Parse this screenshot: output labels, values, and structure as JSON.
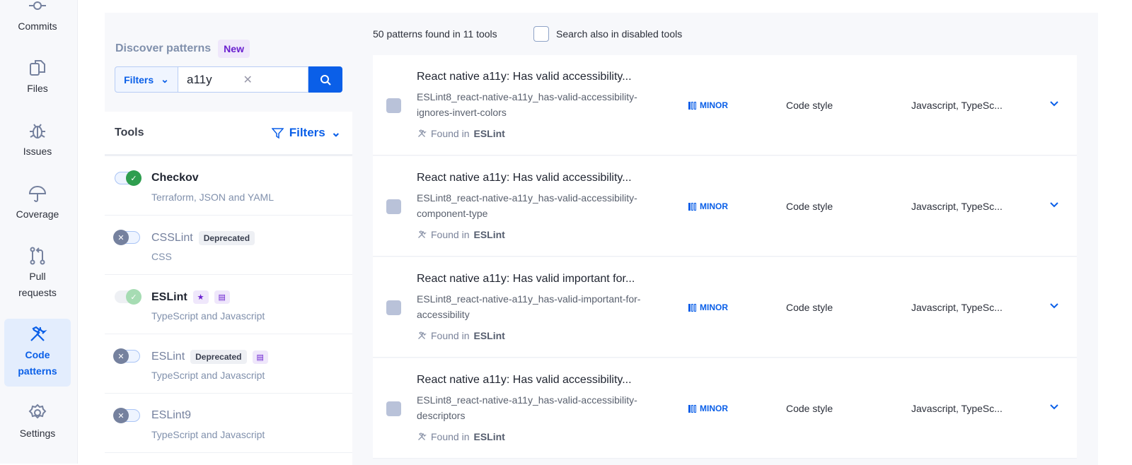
{
  "sidebar": {
    "items": [
      {
        "label": "Commits",
        "icon": "commit-icon"
      },
      {
        "label": "Files",
        "icon": "files-icon"
      },
      {
        "label": "Issues",
        "icon": "bug-icon"
      },
      {
        "label": "Coverage",
        "icon": "umbrella-icon"
      },
      {
        "label": "Pull requests",
        "icon": "pull-request-icon"
      },
      {
        "label": "Code patterns",
        "icon": "tools-icon",
        "active": true
      },
      {
        "label": "Settings",
        "icon": "gear-icon"
      }
    ]
  },
  "discover": {
    "title": "Discover patterns",
    "badge": "New",
    "filters_label": "Filters",
    "search_value": "a11y"
  },
  "tools": {
    "title": "Tools",
    "filters_label": "Filters",
    "items": [
      {
        "name": "Checkov",
        "sub": "Terraform, JSON and YAML",
        "enabled": true
      },
      {
        "name": "CSSLint",
        "sub": "CSS",
        "enabled": false,
        "tag": "Deprecated"
      },
      {
        "name": "ESLint",
        "sub": "TypeScript and Javascript",
        "enabled": true,
        "disabled_toggle": true,
        "icons": [
          "star-icon",
          "doc-icon"
        ]
      },
      {
        "name": "ESLint",
        "sub": "TypeScript and Javascript",
        "enabled": false,
        "tag": "Deprecated",
        "icons": [
          "doc-icon"
        ]
      },
      {
        "name": "ESLint9",
        "sub": "TypeScript and Javascript",
        "enabled": false
      }
    ]
  },
  "results": {
    "count_text": "50 patterns found in 11 tools",
    "disabled_label": "Search also in disabled tools",
    "disabled_checked": false,
    "found_prefix": "Found in",
    "items": [
      {
        "title": "React native a11y: Has valid accessibility...",
        "id": "ESLint8_react-native-a11y_has-valid-accessibility-ignores-invert-colors",
        "tool": "ESLint",
        "severity": "MINOR",
        "category": "Code style",
        "languages": "Javascript, TypeSc..."
      },
      {
        "title": "React native a11y: Has valid accessibility...",
        "id": "ESLint8_react-native-a11y_has-valid-accessibility-component-type",
        "tool": "ESLint",
        "severity": "MINOR",
        "category": "Code style",
        "languages": "Javascript, TypeSc..."
      },
      {
        "title": "React native a11y: Has valid important for...",
        "id": "ESLint8_react-native-a11y_has-valid-important-for-accessibility",
        "tool": "ESLint",
        "severity": "MINOR",
        "category": "Code style",
        "languages": "Javascript, TypeSc..."
      },
      {
        "title": "React native a11y: Has valid accessibility...",
        "id": "ESLint8_react-native-a11y_has-valid-accessibility-descriptors",
        "tool": "ESLint",
        "severity": "MINOR",
        "category": "Code style",
        "languages": "Javascript, TypeSc..."
      }
    ]
  },
  "colors": {
    "accent": "#0a5fe8",
    "enabled": "#2e9e4f",
    "disabled_knob": "#75819e",
    "purple": "#6a1fcf"
  }
}
